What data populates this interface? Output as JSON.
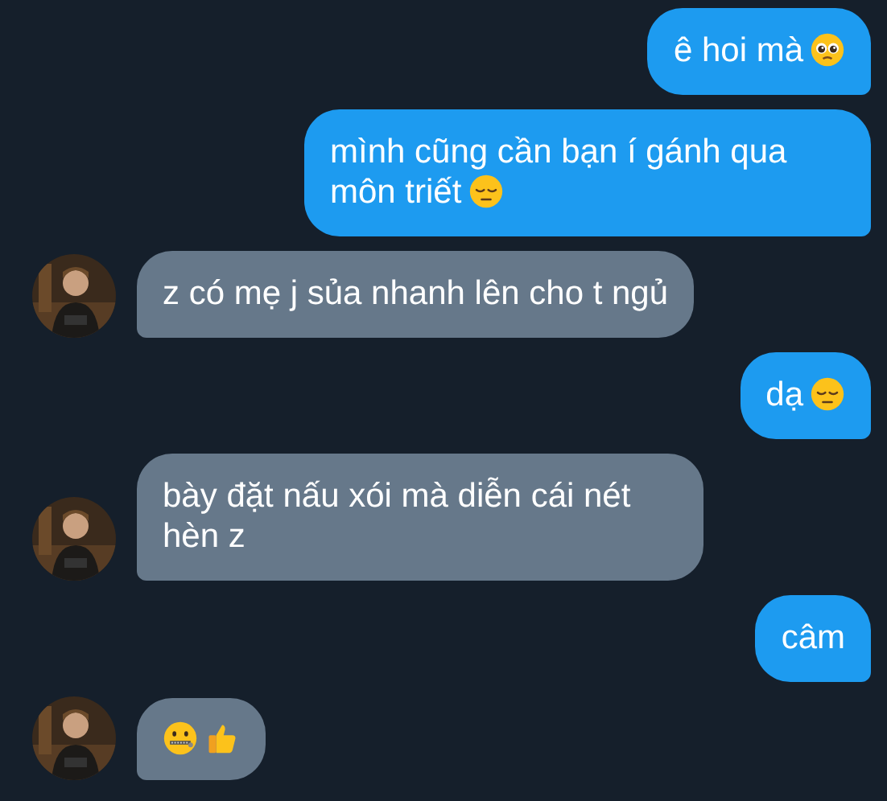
{
  "messages": [
    {
      "kind": "outgoing",
      "text": "ê hoi mà",
      "emoji": [
        {
          "kind": "pleading-face"
        }
      ]
    },
    {
      "kind": "outgoing",
      "text": "mình cũng cần bạn í gánh qua môn triết",
      "emoji": [
        {
          "kind": "pensive-face"
        }
      ]
    },
    {
      "kind": "incoming",
      "text": "z có mẹ j sủa nhanh lên cho t ngủ"
    },
    {
      "kind": "outgoing",
      "text": "dạ",
      "emoji": [
        {
          "kind": "pensive-face"
        }
      ]
    },
    {
      "kind": "incoming",
      "text": "bày đặt nấu xói mà diễn cái nét hèn z"
    },
    {
      "kind": "outgoing",
      "text": "câm"
    },
    {
      "kind": "incoming",
      "emoji": [
        {
          "kind": "zipper-mouth-face"
        },
        {
          "kind": "thumbs-up"
        }
      ]
    }
  ]
}
